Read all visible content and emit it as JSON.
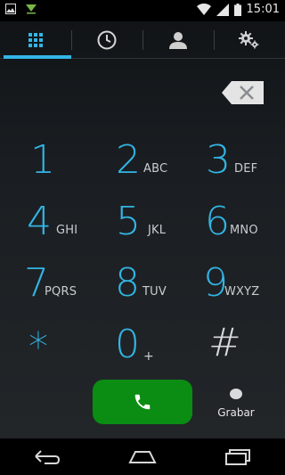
{
  "status_bar": {
    "time": "15:01",
    "left_icons": [
      "image-icon",
      "download-arrow-icon"
    ],
    "right_icons": [
      "wifi-icon",
      "signal-icon",
      "battery-icon"
    ]
  },
  "tabs": [
    {
      "name": "dialpad",
      "icon": "dialpad-icon",
      "active": true
    },
    {
      "name": "recent",
      "icon": "clock-icon",
      "active": false
    },
    {
      "name": "contacts",
      "icon": "person-icon",
      "active": false
    },
    {
      "name": "settings",
      "icon": "gear-icon",
      "active": false
    }
  ],
  "keypad": {
    "keys": [
      {
        "digit": "1",
        "letters": ""
      },
      {
        "digit": "2",
        "letters": "ABC"
      },
      {
        "digit": "3",
        "letters": "DEF"
      },
      {
        "digit": "4",
        "letters": "GHI"
      },
      {
        "digit": "5",
        "letters": "JKL"
      },
      {
        "digit": "6",
        "letters": "MNO"
      },
      {
        "digit": "7",
        "letters": "PQRS"
      },
      {
        "digit": "8",
        "letters": "TUV"
      },
      {
        "digit": "9",
        "letters": "WXYZ"
      },
      {
        "digit": "*",
        "letters": ""
      },
      {
        "digit": "0",
        "letters": "+"
      },
      {
        "digit": "#",
        "letters": ""
      }
    ]
  },
  "actions": {
    "record_label": "Grabar"
  },
  "colors": {
    "accent": "#33b5e5",
    "call_green": "#0a8d12"
  }
}
